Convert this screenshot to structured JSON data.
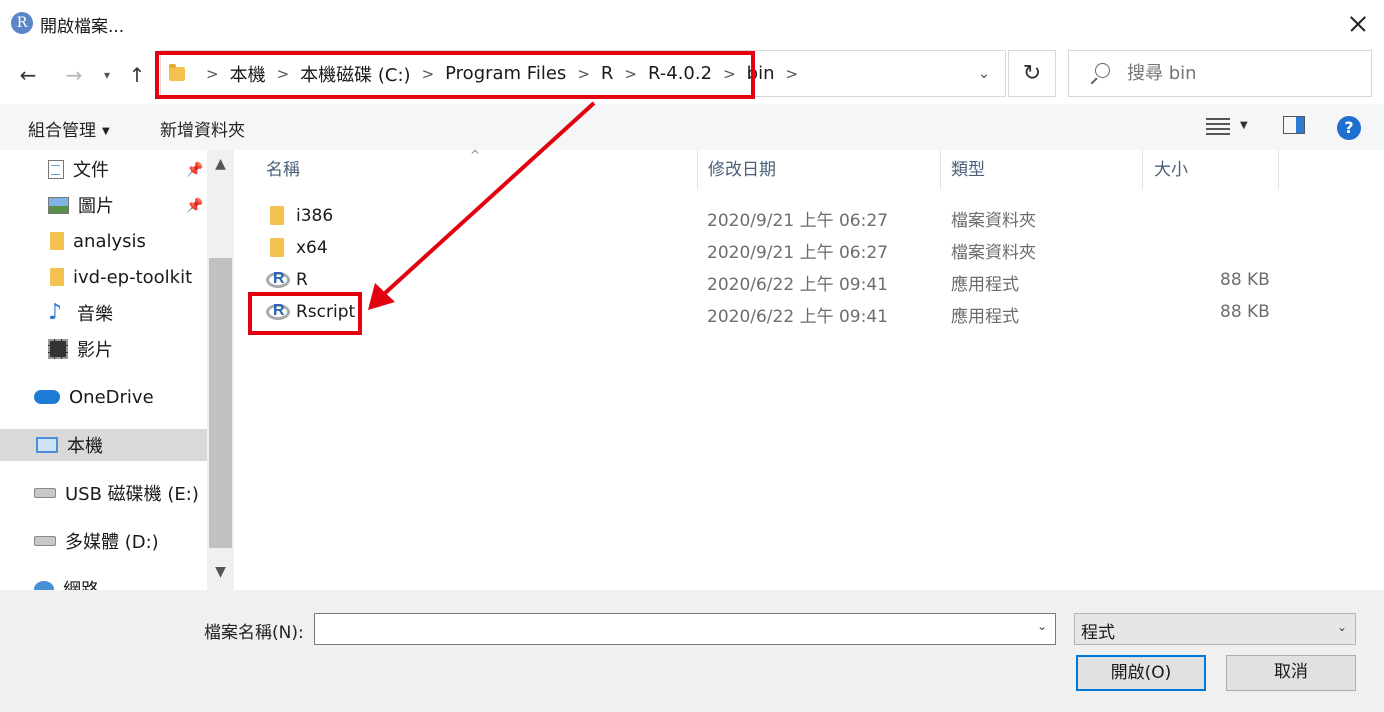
{
  "window": {
    "title": "開啟檔案...",
    "app_icon_letter": "R"
  },
  "nav": {
    "back": "←",
    "forward": "→",
    "recent": "⌄",
    "up": "↑"
  },
  "address": {
    "crumbs": [
      "本機",
      "本機磁碟 (C:)",
      "Program Files",
      "R",
      "R-4.0.2",
      "bin"
    ],
    "refresh": "↻"
  },
  "search": {
    "placeholder": "搜尋 bin"
  },
  "toolbar": {
    "organize_label": "組合管理",
    "new_folder_label": "新增資料夾",
    "help_label": "?"
  },
  "sidebar": {
    "items": [
      {
        "label": "文件",
        "icon": "document-icon",
        "pinned": true
      },
      {
        "label": "圖片",
        "icon": "picture-icon",
        "pinned": true
      },
      {
        "label": "analysis",
        "icon": "folder-icon",
        "pinned": false
      },
      {
        "label": "ivd-ep-toolkit",
        "icon": "folder-icon",
        "pinned": false
      },
      {
        "label": "音樂",
        "icon": "music-icon",
        "pinned": false
      },
      {
        "label": "影片",
        "icon": "video-icon",
        "pinned": false
      },
      {
        "label": "OneDrive",
        "icon": "cloud-icon",
        "pinned": false
      },
      {
        "label": "本機",
        "icon": "computer-icon",
        "pinned": false,
        "selected": true
      },
      {
        "label": "USB 磁碟機 (E:)",
        "icon": "drive-icon",
        "pinned": false
      },
      {
        "label": "多媒體 (D:)",
        "icon": "drive-icon",
        "pinned": false
      },
      {
        "label": "網路",
        "icon": "network-icon",
        "pinned": false
      }
    ]
  },
  "columns": {
    "name": "名稱",
    "modified": "修改日期",
    "type": "類型",
    "size": "大小"
  },
  "files": [
    {
      "name": "i386",
      "modified": "2020/9/21 上午 06:27",
      "type": "檔案資料夾",
      "size": "",
      "icon": "folder-icon"
    },
    {
      "name": "x64",
      "modified": "2020/9/21 上午 06:27",
      "type": "檔案資料夾",
      "size": "",
      "icon": "folder-icon"
    },
    {
      "name": "R",
      "modified": "2020/6/22 上午 09:41",
      "type": "應用程式",
      "size": "88 KB",
      "icon": "r-app-icon"
    },
    {
      "name": "Rscript",
      "modified": "2020/6/22 上午 09:41",
      "type": "應用程式",
      "size": "88 KB",
      "icon": "r-app-icon"
    }
  ],
  "bottom": {
    "filename_label": "檔案名稱(N):",
    "filename_value": "",
    "filetype_value": "程式",
    "open_label": "開啟(O)",
    "cancel_label": "取消"
  },
  "colors": {
    "annotation_red": "#e3000f",
    "accent_blue": "#0078d7"
  }
}
